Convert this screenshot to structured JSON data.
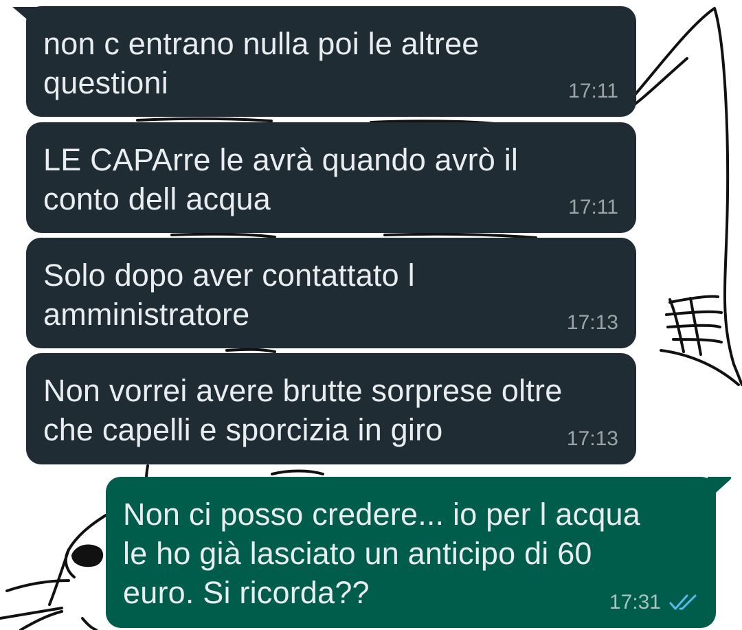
{
  "messages": [
    {
      "direction": "incoming",
      "text": "non c entrano nulla poi le altree\nquestioni",
      "time": "17:11"
    },
    {
      "direction": "incoming",
      "text": "LE CAPArre le avrà quando avrò il\nconto dell acqua",
      "time": "17:11"
    },
    {
      "direction": "incoming",
      "text": "Solo dopo aver contattato l\namministratore",
      "time": "17:13"
    },
    {
      "direction": "incoming",
      "text": "Non vorrei avere brutte sorprese oltre\nche capelli e sporcizia in giro",
      "time": "17:13"
    },
    {
      "direction": "outgoing",
      "text": "Non ci posso credere... io per l acqua\nle ho già lasciato un anticipo di 60\neuro. Si ricorda??",
      "time": "17:31",
      "status_icon": "read-receipt-double-check-icon"
    }
  ],
  "colors": {
    "incoming_bubble": "#1f2c33",
    "outgoing_bubble": "#005c4b",
    "text": "#e9edef",
    "read_ticks": "#53bdeb",
    "wallpaper": "#ffffff"
  }
}
